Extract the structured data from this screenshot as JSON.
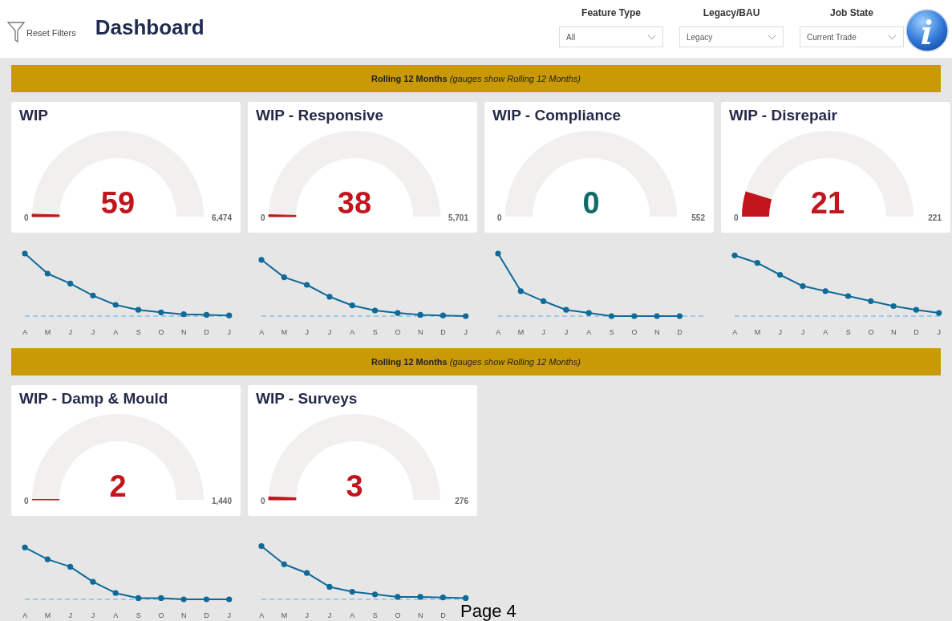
{
  "header": {
    "reset_filters": "Reset Filters",
    "title": "Dashboard",
    "slicers": [
      {
        "label": "Feature Type",
        "value": "All"
      },
      {
        "label": "Legacy/BAU",
        "value": "Legacy"
      },
      {
        "label": "Job State",
        "value": "Current Trade"
      }
    ]
  },
  "sections": [
    {
      "banner": "**Rolling 12 Months** *(gauges show Rolling 12 Months)*",
      "cards": [
        {
          "title": "WIP",
          "value": "59",
          "color": "#c0161c",
          "min": "0",
          "max": "6,474",
          "months": [
            "A",
            "M",
            "J",
            "J",
            "A",
            "S",
            "O",
            "N",
            "D",
            "J"
          ]
        },
        {
          "title": "WIP - Responsive",
          "value": "38",
          "color": "#c0161c",
          "min": "0",
          "max": "5,701",
          "months": [
            "A",
            "M",
            "J",
            "J",
            "A",
            "S",
            "O",
            "N",
            "D",
            "J"
          ]
        },
        {
          "title": "WIP - Compliance",
          "value": "0",
          "color": "#0e6b69",
          "min": "0",
          "max": "552",
          "months": [
            "A",
            "M",
            "J",
            "J",
            "A",
            "S",
            "O",
            "N",
            "D"
          ]
        },
        {
          "title": "WIP - Disrepair",
          "value": "21",
          "color": "#c0161c",
          "min": "0",
          "max": "221",
          "months": [
            "A",
            "M",
            "J",
            "J",
            "A",
            "S",
            "O",
            "N",
            "D",
            "J"
          ]
        }
      ]
    },
    {
      "banner": "**Rolling 12 Months** *(gauges show Rolling 12 Months)*",
      "cards": [
        {
          "title": "WIP - Damp & Mould",
          "value": "2",
          "color": "#c0161c",
          "min": "0",
          "max": "1,440",
          "months": [
            "A",
            "M",
            "J",
            "J",
            "A",
            "S",
            "O",
            "N",
            "D",
            "J"
          ]
        },
        {
          "title": "WIP - Surveys",
          "value": "3",
          "color": "#c0161c",
          "min": "0",
          "max": "276",
          "months": [
            "A",
            "M",
            "J",
            "J",
            "A",
            "S",
            "O",
            "N",
            "D"
          ]
        }
      ]
    }
  ],
  "page_label": "Page 4"
}
